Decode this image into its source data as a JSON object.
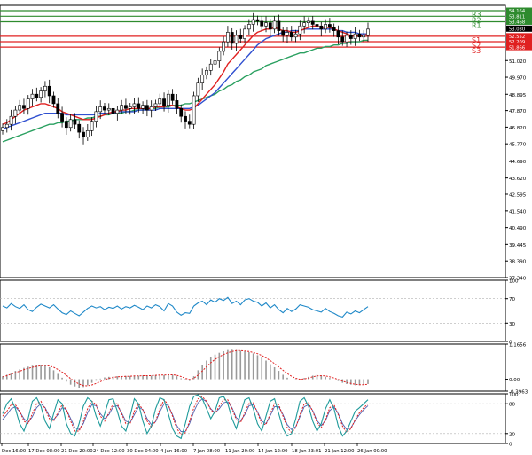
{
  "chart_data": [
    {
      "panel": "price",
      "type": "candlestick",
      "ylim": [
        37.34,
        54.5
      ],
      "y_ticks": [
        "51.020",
        "49.970",
        "48.895",
        "47.870",
        "46.820",
        "45.770",
        "44.690",
        "43.620",
        "42.595",
        "41.540",
        "40.490",
        "39.445",
        "38.390",
        "37.340"
      ],
      "current_price": {
        "label": "53.030",
        "value": 53.03
      },
      "levels": [
        {
          "name": "R3",
          "value": 54.164,
          "label": "54.164",
          "color": "#2e8b2e"
        },
        {
          "name": "R2",
          "value": 53.811,
          "label": "53.811",
          "color": "#2e8b2e"
        },
        {
          "name": "R1",
          "value": 53.468,
          "label": "53.468",
          "color": "#2e8b2e"
        },
        {
          "name": "S1",
          "value": 52.552,
          "label": "52.552",
          "color": "#e02020"
        },
        {
          "name": "S2",
          "value": 52.209,
          "label": "52.209",
          "color": "#e02020"
        },
        {
          "name": "S3",
          "value": 51.866,
          "label": "51.866",
          "color": "#e02020"
        }
      ],
      "close": [
        46.8,
        47.0,
        47.5,
        47.9,
        48.2,
        48.0,
        48.6,
        48.9,
        48.7,
        49.1,
        49.4,
        48.8,
        48.3,
        47.7,
        47.2,
        46.8,
        47.3,
        47.0,
        46.5,
        46.2,
        46.6,
        47.2,
        47.8,
        48.1,
        47.9,
        48.0,
        47.7,
        47.9,
        48.2,
        48.0,
        48.1,
        48.3,
        48.0,
        48.2,
        47.9,
        48.1,
        48.3,
        48.6,
        48.2,
        48.9,
        48.5,
        48.0,
        47.5,
        47.2,
        47.0,
        48.8,
        49.6,
        50.1,
        50.4,
        50.8,
        51.0,
        51.6,
        52.2,
        52.8,
        52.1,
        52.6,
        52.4,
        53.0,
        53.3,
        53.6,
        53.5,
        53.2,
        53.4,
        53.0,
        53.5,
        52.9,
        52.6,
        52.8,
        52.5,
        52.7,
        53.2,
        53.4,
        53.5,
        53.3,
        53.2,
        53.0,
        53.3,
        53.1,
        52.9,
        52.5,
        52.2,
        52.6,
        52.4,
        52.7,
        52.5,
        52.6,
        53.0
      ],
      "ma_fast": [
        47.0,
        47.1,
        47.3,
        47.5,
        47.7,
        47.9,
        48.0,
        48.1,
        48.2,
        48.3,
        48.3,
        48.2,
        48.1,
        48.0,
        47.8,
        47.7,
        47.6,
        47.5,
        47.4,
        47.3,
        47.3,
        47.3,
        47.4,
        47.5,
        47.6,
        47.7,
        47.8,
        47.8,
        47.9,
        47.9,
        48.0,
        48.0,
        48.0,
        48.0,
        48.0,
        48.0,
        48.1,
        48.1,
        48.1,
        48.2,
        48.2,
        48.1,
        48.0,
        47.9,
        47.9,
        48.0,
        48.3,
        48.6,
        48.9,
        49.2,
        49.5,
        49.9,
        50.3,
        50.8,
        51.1,
        51.4,
        51.7,
        52.0,
        52.3,
        52.6,
        52.8,
        52.9,
        53.0,
        53.0,
        53.1,
        53.0,
        52.9,
        52.9,
        52.8,
        52.8,
        52.9,
        53.0,
        53.1,
        53.2,
        53.2,
        53.1,
        53.1,
        53.1,
        53.0,
        52.9,
        52.8,
        52.7,
        52.6,
        52.6,
        52.6,
        52.6,
        52.7
      ],
      "ma_mid": [
        46.7,
        46.8,
        46.9,
        47.0,
        47.1,
        47.2,
        47.3,
        47.4,
        47.5,
        47.6,
        47.7,
        47.7,
        47.7,
        47.7,
        47.7,
        47.6,
        47.6,
        47.6,
        47.6,
        47.6,
        47.6,
        47.6,
        47.6,
        47.7,
        47.7,
        47.7,
        47.7,
        47.8,
        47.8,
        47.8,
        47.8,
        47.8,
        47.9,
        47.9,
        47.9,
        47.9,
        47.9,
        48.0,
        48.0,
        48.0,
        48.0,
        48.0,
        48.0,
        48.0,
        48.0,
        48.1,
        48.2,
        48.4,
        48.6,
        48.8,
        49.0,
        49.3,
        49.6,
        49.9,
        50.2,
        50.5,
        50.8,
        51.1,
        51.4,
        51.7,
        52.0,
        52.2,
        52.4,
        52.5,
        52.6,
        52.7,
        52.8,
        52.8,
        52.9,
        52.9,
        52.9,
        53.0,
        53.0,
        53.0,
        53.0,
        53.0,
        53.0,
        53.0,
        53.0,
        52.9,
        52.9,
        52.8,
        52.8,
        52.8,
        52.7,
        52.7,
        52.7
      ],
      "ma_slow": [
        45.9,
        46.0,
        46.1,
        46.2,
        46.3,
        46.4,
        46.5,
        46.6,
        46.7,
        46.8,
        46.9,
        47.0,
        47.0,
        47.1,
        47.1,
        47.2,
        47.2,
        47.3,
        47.3,
        47.3,
        47.4,
        47.4,
        47.5,
        47.5,
        47.6,
        47.6,
        47.7,
        47.7,
        47.7,
        47.8,
        47.8,
        47.9,
        47.9,
        47.9,
        48.0,
        48.0,
        48.0,
        48.1,
        48.1,
        48.1,
        48.2,
        48.2,
        48.2,
        48.3,
        48.3,
        48.4,
        48.5,
        48.6,
        48.7,
        48.8,
        48.9,
        49.1,
        49.2,
        49.4,
        49.5,
        49.7,
        49.8,
        50.0,
        50.1,
        50.3,
        50.4,
        50.5,
        50.7,
        50.8,
        50.9,
        51.0,
        51.1,
        51.2,
        51.3,
        51.4,
        51.5,
        51.5,
        51.6,
        51.7,
        51.8,
        51.8,
        51.9,
        51.9,
        52.0,
        52.0,
        52.1,
        52.1,
        52.2,
        52.2,
        52.2,
        52.3,
        52.3
      ],
      "colors": {
        "ma_fast": "#e02020",
        "ma_mid": "#3050d0",
        "ma_slow": "#2aa060",
        "candle": "#000000"
      }
    },
    {
      "panel": "oscillator-1",
      "type": "line",
      "ylim": [
        0,
        100
      ],
      "y_ticks": [
        "100",
        "70",
        "30",
        "0"
      ],
      "levels": [
        70,
        30
      ],
      "color": "#1e88c8",
      "values": [
        58,
        55,
        62,
        57,
        54,
        60,
        52,
        49,
        56,
        61,
        58,
        55,
        60,
        53,
        47,
        44,
        50,
        46,
        42,
        48,
        54,
        58,
        55,
        57,
        52,
        56,
        54,
        58,
        53,
        57,
        55,
        59,
        56,
        52,
        58,
        55,
        60,
        57,
        50,
        62,
        58,
        48,
        43,
        47,
        46,
        58,
        63,
        66,
        60,
        68,
        64,
        70,
        67,
        72,
        62,
        66,
        60,
        68,
        70,
        66,
        64,
        58,
        63,
        55,
        60,
        52,
        47,
        54,
        49,
        53,
        60,
        58,
        56,
        52,
        50,
        48,
        54,
        49,
        46,
        42,
        40,
        48,
        45,
        50,
        47,
        52,
        57
      ]
    },
    {
      "panel": "oscillator-2",
      "type": "histogram",
      "ylim": [
        -0.3963,
        1.1656
      ],
      "y_ticks": [
        "1.1656",
        "0.00",
        "-0.3963"
      ],
      "colors": {
        "bars": "#9a9a9a",
        "signal": "#e02020"
      },
      "values": [
        0.1,
        0.15,
        0.22,
        0.28,
        0.33,
        0.38,
        0.42,
        0.45,
        0.47,
        0.48,
        0.46,
        0.4,
        0.3,
        0.18,
        0.05,
        -0.08,
        -0.18,
        -0.24,
        -0.28,
        -0.26,
        -0.2,
        -0.12,
        -0.05,
        0.02,
        0.06,
        0.08,
        0.09,
        0.1,
        0.1,
        0.11,
        0.11,
        0.12,
        0.12,
        0.13,
        0.13,
        0.12,
        0.14,
        0.15,
        0.14,
        0.16,
        0.15,
        0.1,
        0.03,
        -0.04,
        -0.06,
        0.1,
        0.3,
        0.48,
        0.62,
        0.74,
        0.82,
        0.88,
        0.93,
        0.97,
        0.98,
        0.97,
        0.95,
        0.93,
        0.9,
        0.86,
        0.8,
        0.72,
        0.62,
        0.5,
        0.4,
        0.28,
        0.15,
        0.05,
        0.0,
        -0.02,
        0.0,
        0.04,
        0.08,
        0.12,
        0.14,
        0.12,
        0.08,
        0.04,
        0.0,
        -0.06,
        -0.12,
        -0.16,
        -0.18,
        -0.2,
        -0.2,
        -0.18,
        -0.16
      ],
      "signal": [
        0.08,
        0.12,
        0.17,
        0.22,
        0.27,
        0.32,
        0.36,
        0.4,
        0.43,
        0.45,
        0.46,
        0.44,
        0.4,
        0.33,
        0.24,
        0.13,
        0.02,
        -0.08,
        -0.16,
        -0.21,
        -0.22,
        -0.19,
        -0.14,
        -0.08,
        -0.02,
        0.03,
        0.06,
        0.08,
        0.09,
        0.1,
        0.1,
        0.11,
        0.11,
        0.12,
        0.12,
        0.12,
        0.13,
        0.14,
        0.14,
        0.15,
        0.15,
        0.13,
        0.09,
        0.03,
        -0.01,
        0.03,
        0.14,
        0.28,
        0.42,
        0.55,
        0.66,
        0.75,
        0.82,
        0.88,
        0.92,
        0.95,
        0.95,
        0.94,
        0.92,
        0.89,
        0.85,
        0.79,
        0.71,
        0.62,
        0.52,
        0.41,
        0.3,
        0.19,
        0.1,
        0.03,
        0.0,
        0.01,
        0.04,
        0.08,
        0.11,
        0.12,
        0.11,
        0.08,
        0.04,
        -0.01,
        -0.06,
        -0.11,
        -0.14,
        -0.17,
        -0.18,
        -0.18,
        -0.17
      ]
    },
    {
      "panel": "oscillator-3",
      "type": "line",
      "ylim": [
        0,
        100
      ],
      "y_ticks": [
        "100",
        "80",
        "20",
        "0"
      ],
      "levels": [
        80,
        20
      ],
      "colors": {
        "main": "#1e9a9a",
        "signal": "#e02020"
      },
      "main": [
        60,
        80,
        90,
        70,
        40,
        25,
        50,
        85,
        92,
        75,
        45,
        30,
        60,
        88,
        80,
        40,
        20,
        15,
        40,
        75,
        92,
        85,
        55,
        35,
        60,
        88,
        90,
        65,
        35,
        25,
        55,
        90,
        80,
        45,
        20,
        35,
        70,
        92,
        88,
        60,
        30,
        15,
        10,
        40,
        75,
        95,
        98,
        90,
        70,
        50,
        65,
        92,
        95,
        80,
        50,
        30,
        60,
        88,
        92,
        70,
        40,
        25,
        55,
        85,
        90,
        60,
        30,
        15,
        20,
        50,
        85,
        92,
        75,
        45,
        25,
        40,
        70,
        88,
        70,
        35,
        15,
        25,
        45,
        65,
        72,
        80,
        88
      ],
      "signal": [
        55,
        65,
        78,
        78,
        65,
        45,
        40,
        60,
        80,
        85,
        70,
        50,
        45,
        62,
        78,
        68,
        45,
        25,
        25,
        45,
        70,
        85,
        78,
        55,
        45,
        62,
        80,
        80,
        60,
        40,
        40,
        65,
        80,
        68,
        45,
        33,
        45,
        70,
        88,
        78,
        55,
        30,
        18,
        22,
        45,
        72,
        90,
        94,
        85,
        68,
        60,
        75,
        88,
        88,
        70,
        48,
        42,
        62,
        82,
        82,
        62,
        40,
        38,
        60,
        80,
        78,
        55,
        32,
        22,
        32,
        58,
        80,
        82,
        65,
        42,
        32,
        48,
        72,
        78,
        58,
        35,
        22,
        30,
        48,
        62,
        72,
        80
      ],
      "secondary_signal": [
        48,
        58,
        70,
        74,
        64,
        50,
        42,
        54,
        72,
        80,
        72,
        55,
        48,
        58,
        72,
        68,
        50,
        32,
        28,
        40,
        62,
        78,
        76,
        60,
        50,
        58,
        74,
        76,
        62,
        45,
        42,
        58,
        74,
        68,
        50,
        38,
        44,
        64,
        80,
        76,
        58,
        36,
        24,
        24,
        40,
        64,
        82,
        90,
        84,
        70,
        62,
        70,
        82,
        84,
        72,
        52,
        46,
        58,
        76,
        78,
        64,
        45,
        40,
        56,
        74,
        74,
        58,
        38,
        28,
        34,
        54,
        74,
        78,
        66,
        46,
        36,
        46,
        66,
        74,
        60,
        40,
        28,
        32,
        46,
        58,
        68,
        76
      ]
    }
  ],
  "x_axis": {
    "labels": [
      "Dec 16:00",
      "17 Dec 08:00",
      "21 Dec 20:00",
      "24 Dec 12:00",
      "30 Dec 04:00",
      "4 Jan 16:00",
      "7 Jan 08:00",
      "11 Jan 20:00",
      "14 Jan 12:00",
      "18 Jan 23:01",
      "21 Jan 12:00",
      "26 Jan 00:00"
    ]
  }
}
